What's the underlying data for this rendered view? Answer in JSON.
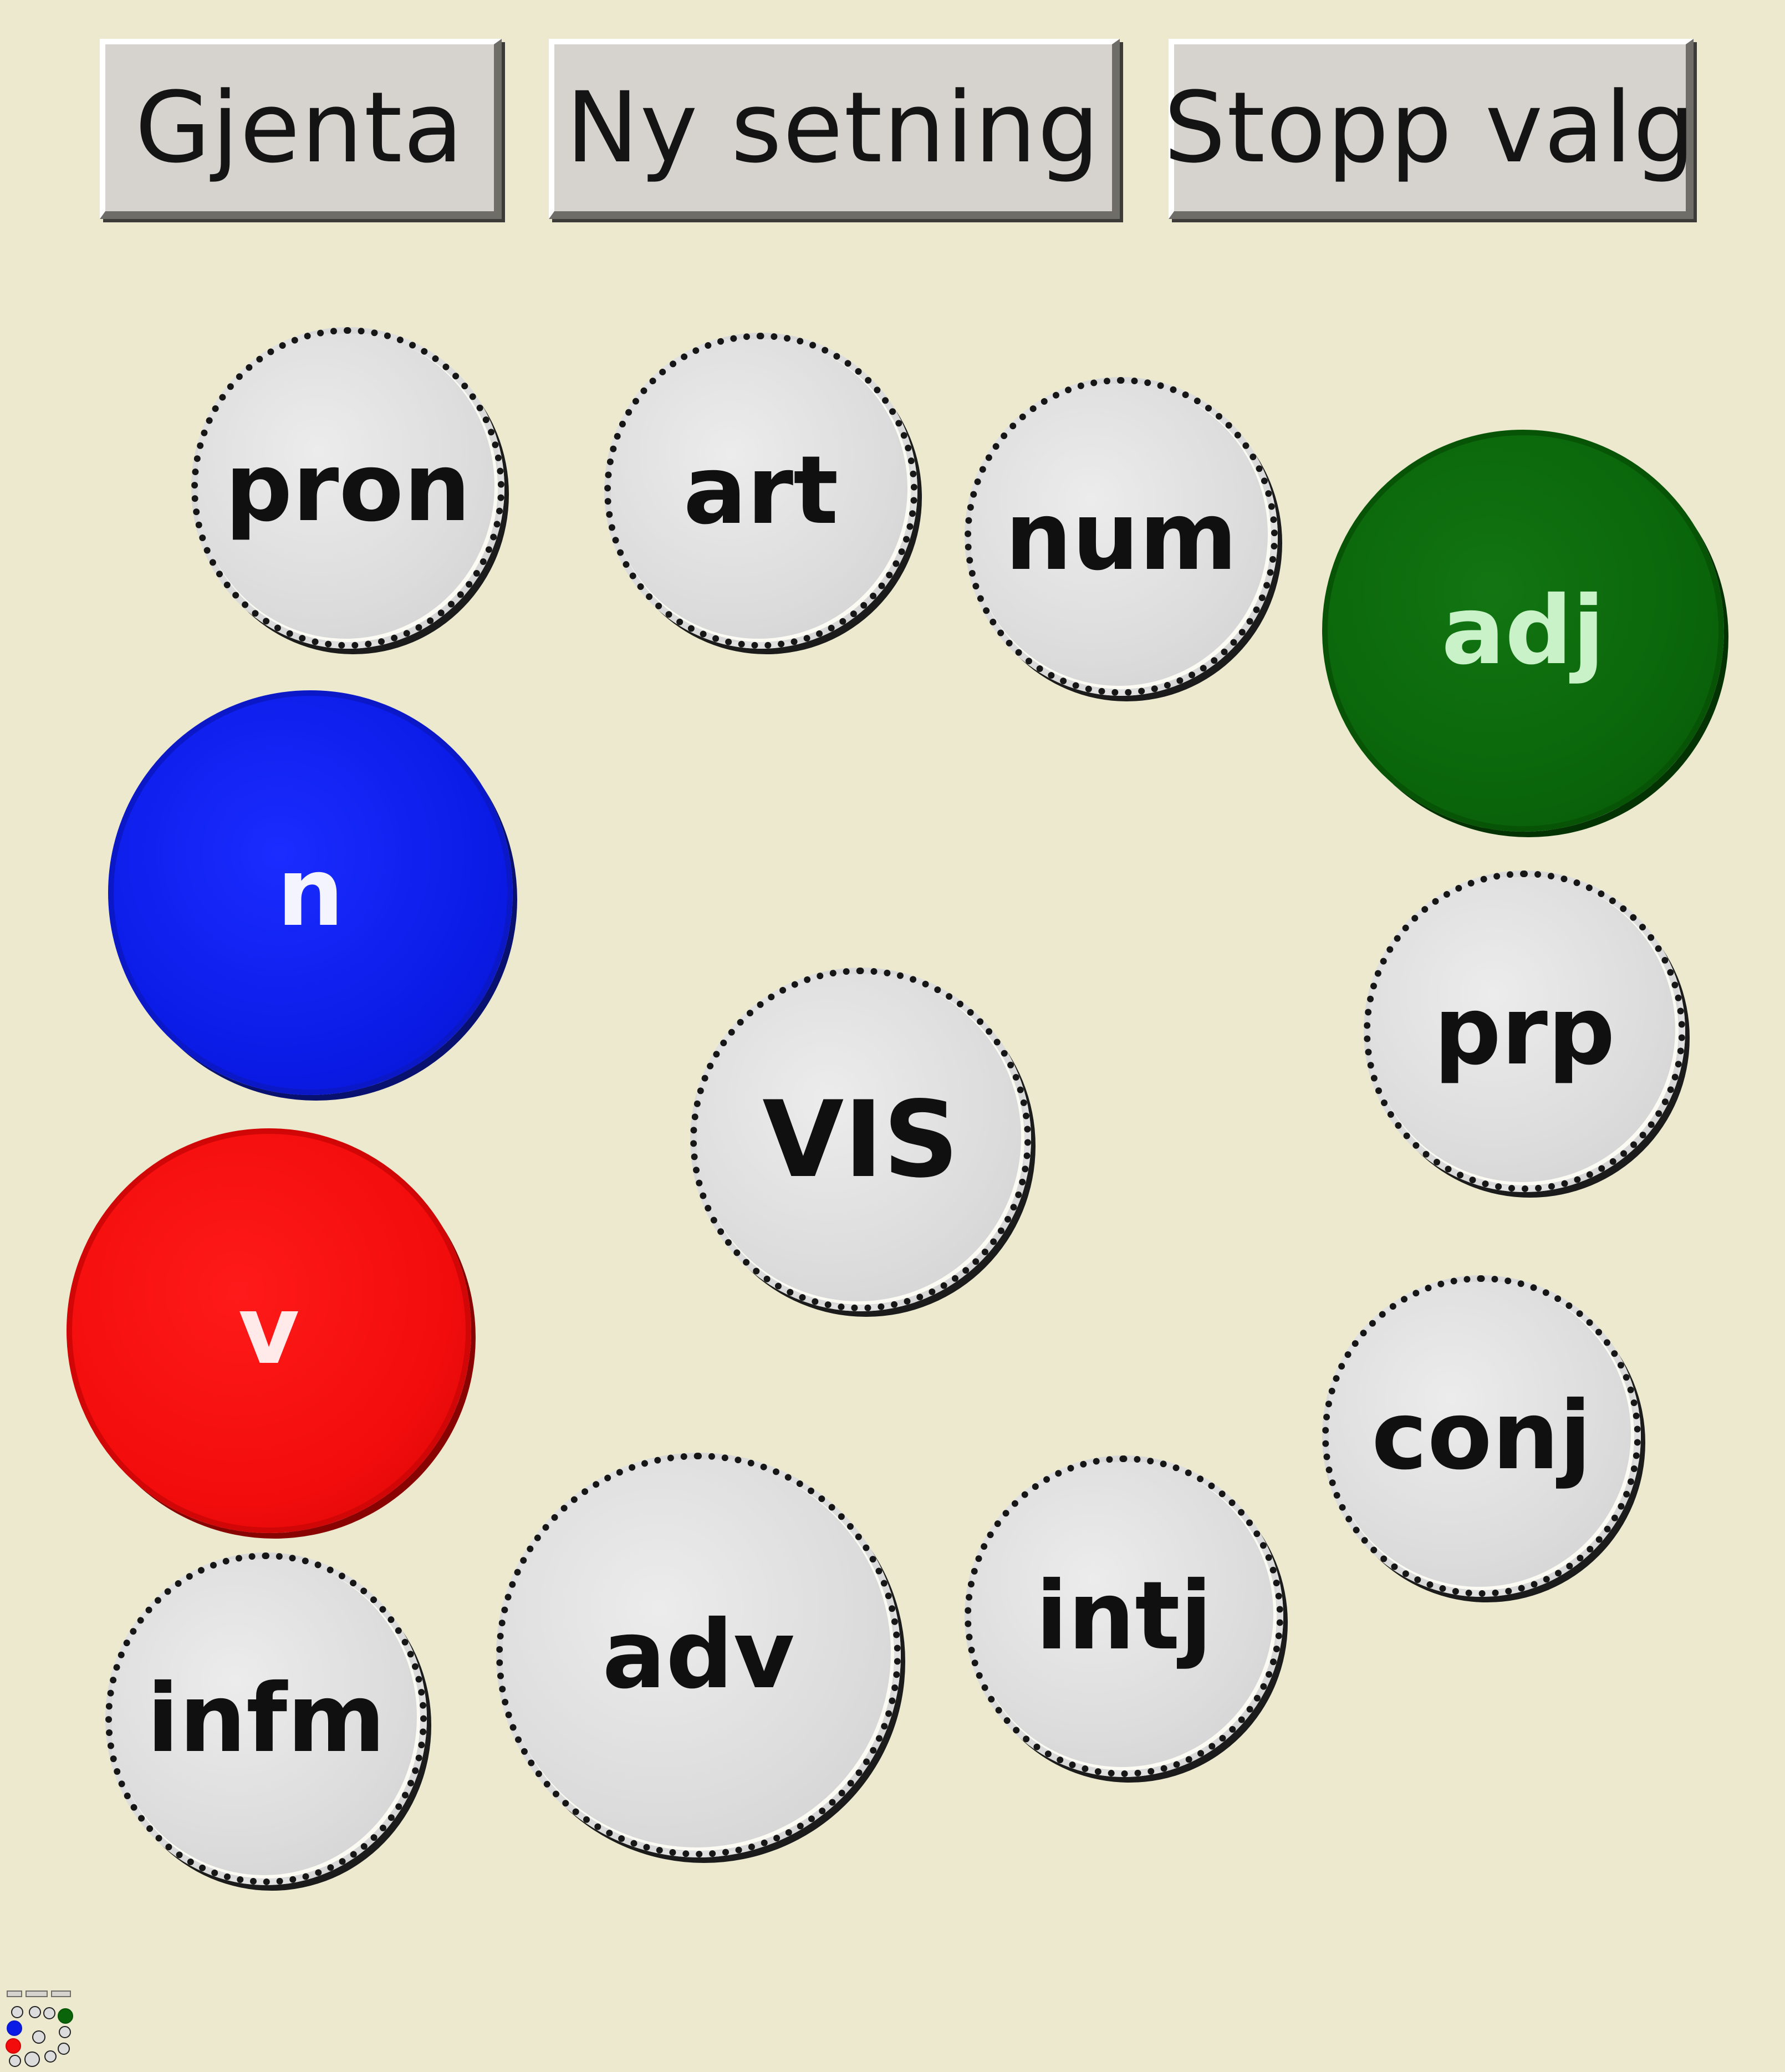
{
  "toolbar": {
    "repeat_label": "Gjenta",
    "new_sentence_label": "Ny setning",
    "stop_choice_label": "Stopp valg"
  },
  "bubbles": {
    "pron": "pron",
    "art": "art",
    "num": "num",
    "adj": "adj",
    "n": "n",
    "prp": "prp",
    "vis": "VIS",
    "v": "v",
    "conj": "conj",
    "infm": "infm",
    "adv": "adv",
    "intj": "intj"
  },
  "colors": {
    "background": "#ece9cf",
    "noun_selected": "#0b1be6",
    "verb_selected": "#f20c0c",
    "adjective_selected": "#0a650a",
    "unselected": "#dcdcdc"
  }
}
